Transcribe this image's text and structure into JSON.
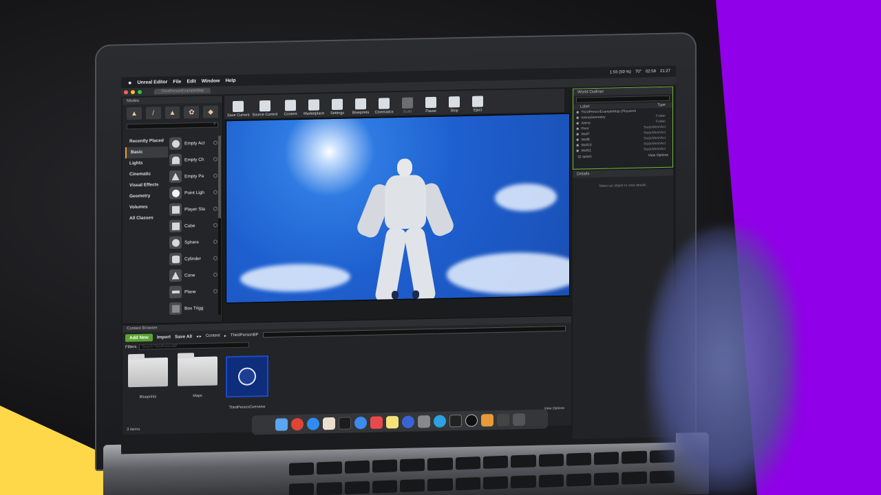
{
  "menubar": {
    "app_name": "Unreal Editor",
    "menus": [
      "File",
      "Edit",
      "Window",
      "Help"
    ],
    "battery": "1:55 (50 %)",
    "temp": "70°",
    "clock": "02:59",
    "time": "21:27"
  },
  "titlebar": {
    "doc_tab": "ThirdPersonExampleMap"
  },
  "modes": {
    "title": "Modes",
    "categories": [
      "Recently Placed",
      "Basic",
      "Lights",
      "Cinematic",
      "Visual Effects",
      "Geometry",
      "Volumes",
      "All Classes"
    ],
    "places": [
      "Empty Act",
      "Empty Ch",
      "Empty Pa",
      "Point Ligh",
      "Player Sta",
      "Cube",
      "Sphere",
      "Cylinder",
      "Cone",
      "Plane",
      "Box Trigg"
    ]
  },
  "toolbar": {
    "items": [
      "Save Current",
      "Source Control",
      "Content",
      "Marketplace",
      "Settings",
      "Blueprints",
      "Cinematics",
      "Build",
      "Pause",
      "Stop",
      "Eject"
    ]
  },
  "outliner": {
    "title": "World Outliner",
    "col_label": "Label",
    "col_type": "Type",
    "rows": [
      {
        "label": "ThirdPersonExampleMap (Playwork",
        "type": ""
      },
      {
        "label": "ArenaGeometry",
        "type": "Folder"
      },
      {
        "label": "Arena",
        "type": "Folder"
      },
      {
        "label": "Floor",
        "type": "StaticMeshAct"
      },
      {
        "label": "Wall7",
        "type": "StaticMeshAct"
      },
      {
        "label": "Wall8",
        "type": "StaticMeshAct"
      },
      {
        "label": "Wall10",
        "type": "StaticMeshAct"
      },
      {
        "label": "Wall11",
        "type": "StaticMeshAct"
      }
    ],
    "actor_count": "32 actors",
    "view_options": "View Options"
  },
  "details": {
    "title": "Details",
    "empty_message": "Select an object to view details."
  },
  "content_browser": {
    "title": "Content Browser",
    "add_new": "Add New",
    "import": "Import",
    "save_all": "Save All",
    "path": [
      "Content",
      "ThirdPersonBP"
    ],
    "filters": "Filters",
    "search_placeholder": "Search ThirdPersonBP",
    "assets": [
      "Blueprints",
      "Maps",
      "ThirdPersonOverview"
    ],
    "items_count": "3 items",
    "view_options": "View Options"
  },
  "colors": {
    "accent_green": "#5aa332",
    "selection_blue": "#1c4ac9",
    "purple": "#9000e8",
    "yellow": "#ffd84a"
  }
}
